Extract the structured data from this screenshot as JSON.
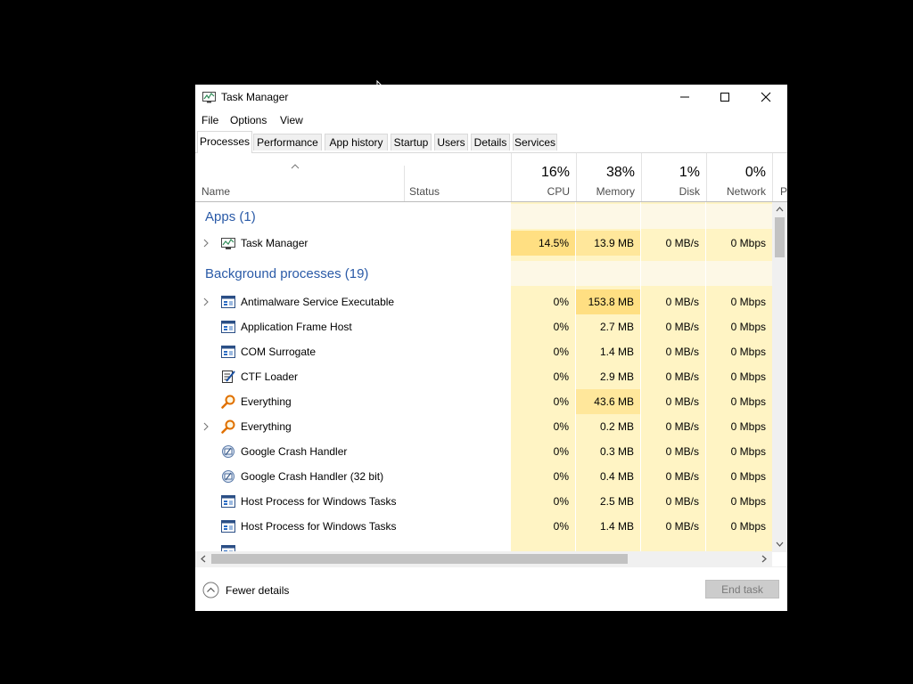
{
  "window": {
    "title": "Task Manager"
  },
  "menu": {
    "file": "File",
    "options": "Options",
    "view": "View"
  },
  "tabs": [
    "Processes",
    "Performance",
    "App history",
    "Startup",
    "Users",
    "Details",
    "Services"
  ],
  "columns": {
    "name": "Name",
    "status": "Status",
    "cpu": {
      "pct": "16%",
      "label": "CPU"
    },
    "memory": {
      "pct": "38%",
      "label": "Memory"
    },
    "disk": {
      "pct": "1%",
      "label": "Disk"
    },
    "network": {
      "pct": "0%",
      "label": "Network"
    },
    "power_partial": "P"
  },
  "groups": {
    "apps": "Apps (1)",
    "background": "Background processes (19)"
  },
  "apps": [
    {
      "name": "Task Manager",
      "cpu": "14.5%",
      "memory": "13.9 MB",
      "disk": "0 MB/s",
      "network": "0 Mbps",
      "icon": "task-manager-icon",
      "expandable": true
    }
  ],
  "background": [
    {
      "name": "Antimalware Service Executable",
      "cpu": "0%",
      "memory": "153.8 MB",
      "disk": "0 MB/s",
      "network": "0 Mbps",
      "icon": "window-app-icon",
      "expandable": true
    },
    {
      "name": "Application Frame Host",
      "cpu": "0%",
      "memory": "2.7 MB",
      "disk": "0 MB/s",
      "network": "0 Mbps",
      "icon": "window-app-icon",
      "expandable": false
    },
    {
      "name": "COM Surrogate",
      "cpu": "0%",
      "memory": "1.4 MB",
      "disk": "0 MB/s",
      "network": "0 Mbps",
      "icon": "window-app-icon",
      "expandable": false
    },
    {
      "name": "CTF Loader",
      "cpu": "0%",
      "memory": "2.9 MB",
      "disk": "0 MB/s",
      "network": "0 Mbps",
      "icon": "pen-notepad-icon",
      "expandable": false
    },
    {
      "name": "Everything",
      "cpu": "0%",
      "memory": "43.6 MB",
      "disk": "0 MB/s",
      "network": "0 Mbps",
      "icon": "magnifier-icon",
      "expandable": false
    },
    {
      "name": "Everything",
      "cpu": "0%",
      "memory": "0.2 MB",
      "disk": "0 MB/s",
      "network": "0 Mbps",
      "icon": "magnifier-icon",
      "expandable": true
    },
    {
      "name": "Google Crash Handler",
      "cpu": "0%",
      "memory": "0.3 MB",
      "disk": "0 MB/s",
      "network": "0 Mbps",
      "icon": "google-crash-icon",
      "expandable": false
    },
    {
      "name": "Google Crash Handler (32 bit)",
      "cpu": "0%",
      "memory": "0.4 MB",
      "disk": "0 MB/s",
      "network": "0 Mbps",
      "icon": "google-crash-icon",
      "expandable": false
    },
    {
      "name": "Host Process for Windows Tasks",
      "cpu": "0%",
      "memory": "2.5 MB",
      "disk": "0 MB/s",
      "network": "0 Mbps",
      "icon": "window-app-icon",
      "expandable": false
    },
    {
      "name": "Host Process for Windows Tasks",
      "cpu": "0%",
      "memory": "1.4 MB",
      "disk": "0 MB/s",
      "network": "0 Mbps",
      "icon": "window-app-icon",
      "expandable": false
    }
  ],
  "footer": {
    "fewer_details": "Fewer details",
    "end_task": "End task"
  },
  "colors": {
    "accent_text": "#2a5aa7",
    "heat_light": "#fff4c4",
    "heat_group": "#fdf8e6",
    "heat_medium": "#ffe79b",
    "heat_strong": "#ffdf82"
  }
}
